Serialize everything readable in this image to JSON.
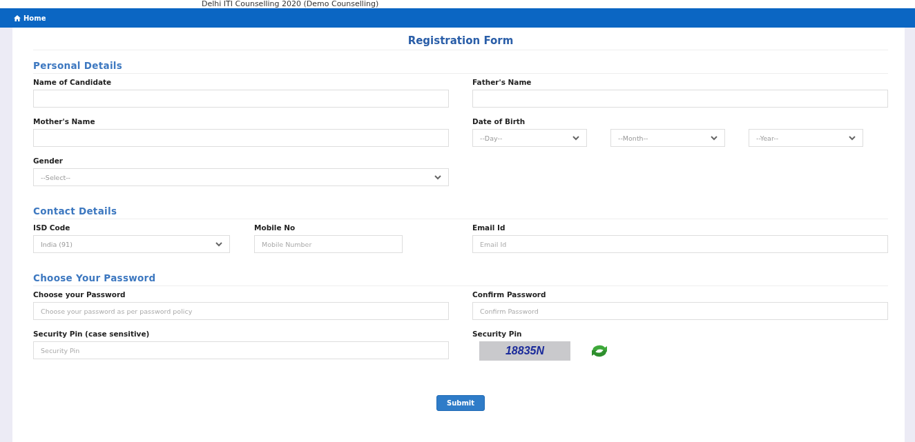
{
  "top_title": "Delhi ITI Counselling 2020 (Demo Counselling)",
  "nav": {
    "home": "Home"
  },
  "form": {
    "title": "Registration Form",
    "sections": [
      {
        "heading": "Personal Details",
        "rows": [
          [
            {
              "fields": [
                {
                  "kind": "input",
                  "label": "Name of Candidate"
                }
              ]
            },
            {
              "fields": [
                {
                  "kind": "input",
                  "label": "Father's Name"
                }
              ]
            }
          ],
          [
            {
              "fields": [
                {
                  "kind": "input",
                  "label": "Mother's Name"
                }
              ]
            },
            {
              "fields": [
                {
                  "kind": "dates",
                  "label": "Date of Birth",
                  "options": [
                    "--Day--",
                    "--Month--",
                    "--Year--"
                  ]
                }
              ]
            }
          ],
          [
            {
              "fields": [
                {
                  "kind": "select",
                  "label": "Gender",
                  "value": "--Select--"
                }
              ]
            }
          ]
        ]
      },
      {
        "heading": "Contact Details",
        "rows": [
          [
            {
              "fields": [
                {
                  "kind": "select",
                  "label": "ISD Code",
                  "value": "India (91)"
                },
                {
                  "kind": "input",
                  "label": "Mobile No",
                  "placeholder": "Mobile Number"
                }
              ]
            },
            {
              "fields": [
                {
                  "kind": "input",
                  "label": "Email Id",
                  "placeholder": "Email Id"
                }
              ]
            }
          ]
        ]
      },
      {
        "heading": "Choose Your Password",
        "rows": [
          [
            {
              "fields": [
                {
                  "kind": "input",
                  "label": "Choose your Password",
                  "placeholder": "Choose your password as per password policy"
                }
              ]
            },
            {
              "fields": [
                {
                  "kind": "input",
                  "label": "Confirm Password",
                  "placeholder": "Confirm Password"
                }
              ]
            }
          ],
          [
            {
              "fields": [
                {
                  "kind": "input",
                  "label": "Security Pin (case sensitive)",
                  "placeholder": "Security Pin"
                }
              ]
            },
            {
              "fields": [
                {
                  "kind": "captcha",
                  "label": "Security Pin",
                  "code": "18835N"
                }
              ]
            }
          ]
        ]
      }
    ],
    "submit": "Submit"
  }
}
